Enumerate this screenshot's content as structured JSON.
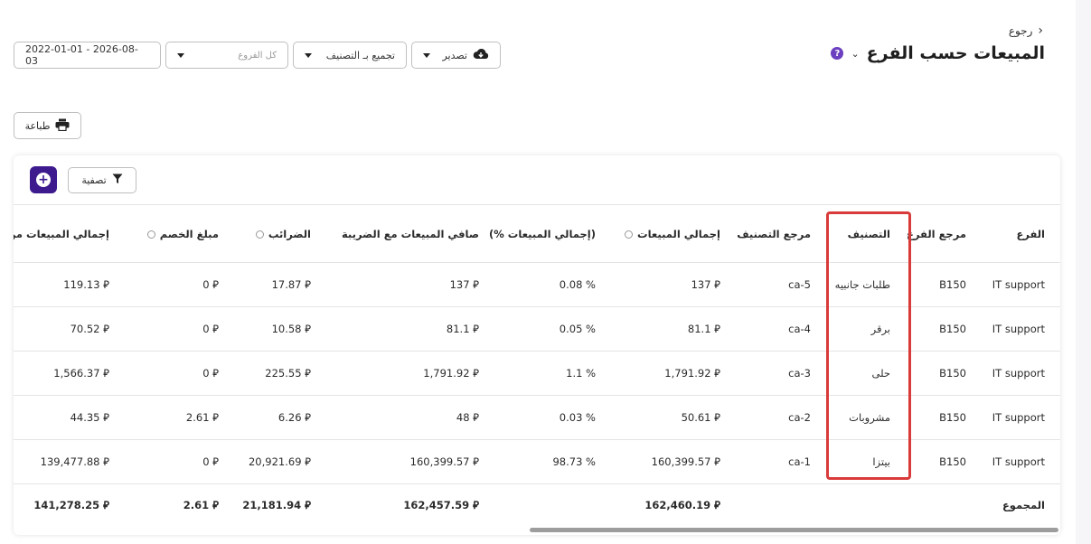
{
  "header": {
    "back_label": "رجوع",
    "title": "المبيعات حسب الفرع",
    "help_icon_text": "?"
  },
  "controls": {
    "export_label": "تصدير",
    "group_label": "تجميع بـ التصنيف",
    "branch_placeholder": "كل الفروع",
    "date_range": "2022-01-01 - 2026-08-03",
    "print_label": "طباعة",
    "filter_label": "تصفية"
  },
  "table": {
    "columns": [
      "الفرع",
      "مرجع الفرع",
      "التصنيف",
      "مرجع التصنيف",
      "إجمالي المبيعات",
      "(إجمالي المبيعات %)",
      "صافي المبيعات مع الضريبة",
      "الضرائب",
      "مبلغ الخصم",
      "إجمالي المبيعات من غير"
    ],
    "rows": [
      {
        "branch": "IT support",
        "branch_ref": "B150",
        "category": "طلبات جانبيه",
        "category_ref": "ca-5",
        "total_sales": "137 ⃁",
        "pct": "0.08 %",
        "net_tax": "137 ⃁",
        "taxes": "17.87 ⃁",
        "discount": "0 ⃁",
        "total_no_tax": "119.13 ⃁"
      },
      {
        "branch": "IT support",
        "branch_ref": "B150",
        "category": "برقر",
        "category_ref": "ca-4",
        "total_sales": "81.1 ⃁",
        "pct": "0.05 %",
        "net_tax": "81.1 ⃁",
        "taxes": "10.58 ⃁",
        "discount": "0 ⃁",
        "total_no_tax": "70.52 ⃁"
      },
      {
        "branch": "IT support",
        "branch_ref": "B150",
        "category": "حلى",
        "category_ref": "ca-3",
        "total_sales": "1,791.92 ⃁",
        "pct": "1.1 %",
        "net_tax": "1,791.92 ⃁",
        "taxes": "225.55 ⃁",
        "discount": "0 ⃁",
        "total_no_tax": "1,566.37 ⃁"
      },
      {
        "branch": "IT support",
        "branch_ref": "B150",
        "category": "مشروبات",
        "category_ref": "ca-2",
        "total_sales": "50.61 ⃁",
        "pct": "0.03 %",
        "net_tax": "48 ⃁",
        "taxes": "6.26 ⃁",
        "discount": "2.61 ⃁",
        "total_no_tax": "44.35 ⃁"
      },
      {
        "branch": "IT support",
        "branch_ref": "B150",
        "category": "بيتزا",
        "category_ref": "ca-1",
        "total_sales": "160,399.57 ⃁",
        "pct": "98.73 %",
        "net_tax": "160,399.57 ⃁",
        "taxes": "20,921.69 ⃁",
        "discount": "0 ⃁",
        "total_no_tax": "139,477.88 ⃁"
      }
    ],
    "total": {
      "label": "المجموع",
      "total_sales": "162,460.19 ⃁",
      "net_tax": "162,457.59 ⃁",
      "taxes": "21,181.94 ⃁",
      "discount": "2.61 ⃁",
      "total_no_tax": "141,278.25 ⃁"
    }
  },
  "colors": {
    "accent": "#3d1a8e",
    "help": "#6b3fbf",
    "highlight": "#d93a3a"
  },
  "icons": [
    "chevron-left-icon",
    "chevron-down-icon",
    "help-icon",
    "cloud-download-icon",
    "printer-icon",
    "filter-icon",
    "add-circle-icon",
    "info-icon"
  ]
}
